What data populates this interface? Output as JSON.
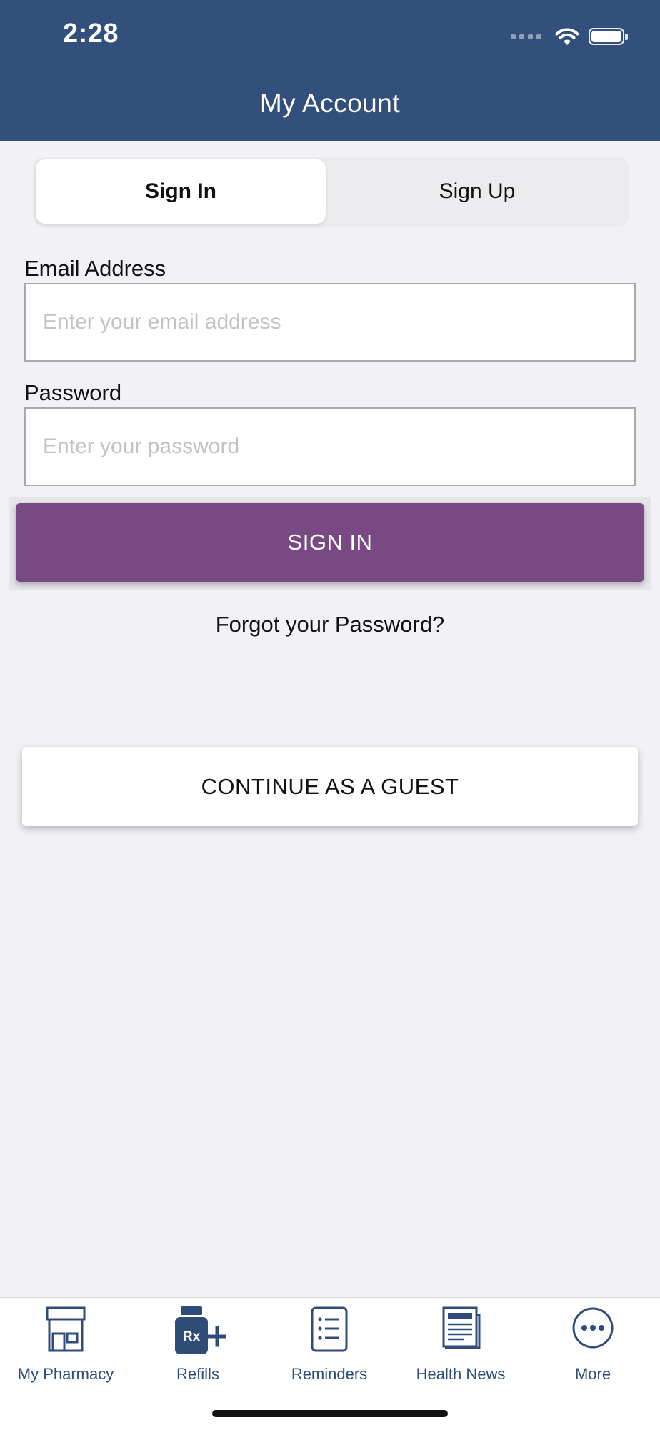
{
  "status_bar": {
    "time": "2:28"
  },
  "header": {
    "title": "My Account"
  },
  "segmented": {
    "active": "Sign In",
    "inactive": "Sign Up"
  },
  "form": {
    "email_label": "Email Address",
    "email_placeholder": "Enter your email address",
    "email_value": "",
    "password_label": "Password",
    "password_placeholder": "Enter your password",
    "password_value": "",
    "sign_in_label": "SIGN IN",
    "forgot_label": "Forgot your Password?"
  },
  "guest": {
    "label": "CONTINUE AS A GUEST"
  },
  "tabbar": {
    "items": [
      {
        "label": "My Pharmacy",
        "icon": "storefront-icon"
      },
      {
        "label": "Refills",
        "icon": "rx-bottle-plus-icon",
        "badge_text": "Rx"
      },
      {
        "label": "Reminders",
        "icon": "checklist-icon"
      },
      {
        "label": "Health News",
        "icon": "newspaper-icon"
      },
      {
        "label": "More",
        "icon": "more-circle-icon"
      }
    ]
  },
  "colors": {
    "header_bg": "#32507b",
    "primary_button": "#784983",
    "tab_icon": "#2f4c79",
    "page_bg": "#f2f2f6"
  }
}
